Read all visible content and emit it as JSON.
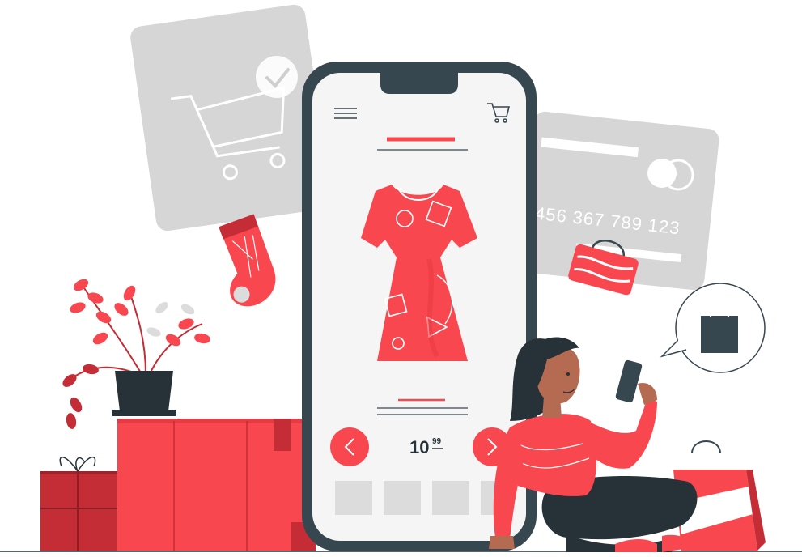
{
  "product": {
    "price_main": "10",
    "price_cents": "99"
  },
  "card": {
    "number_fragment": "456 367 789 123"
  },
  "colors": {
    "accent": "#f9474f",
    "accent_dark": "#c42d35",
    "phone_frame": "#37474f",
    "screen_bg": "#f5f5f5",
    "gray_card": "#d9d9d9",
    "ink": "#263238"
  },
  "icons": [
    "hamburger-menu-icon",
    "shopping-cart-icon",
    "prev-arrow-icon",
    "next-arrow-icon",
    "shopping-bag-icon",
    "checkmark-icon"
  ]
}
